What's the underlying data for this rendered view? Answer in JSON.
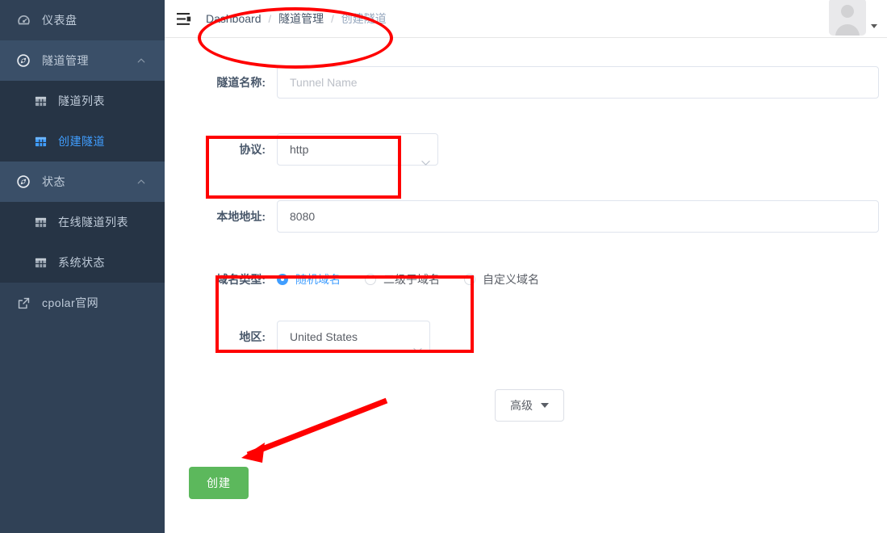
{
  "sidebar": {
    "items": [
      {
        "label": "仪表盘",
        "icon": "dashboard-icon",
        "type": "item"
      },
      {
        "label": "隧道管理",
        "icon": "compass-icon",
        "type": "group",
        "expanded": true,
        "children": [
          {
            "label": "隧道列表",
            "icon": "grid-icon",
            "active": false
          },
          {
            "label": "创建隧道",
            "icon": "grid-icon",
            "active": true
          }
        ]
      },
      {
        "label": "状态",
        "icon": "compass-icon",
        "type": "group",
        "expanded": true,
        "children": [
          {
            "label": "在线隧道列表",
            "icon": "grid-icon",
            "active": false
          },
          {
            "label": "系统状态",
            "icon": "grid-icon",
            "active": false
          }
        ]
      },
      {
        "label": "cpolar官网",
        "icon": "external-link-icon",
        "type": "item"
      }
    ]
  },
  "topbar": {
    "menu_toggle_icon": "hamburger-icon",
    "breadcrumbs": [
      {
        "label": "Dashboard",
        "current": false
      },
      {
        "label": "隧道管理",
        "current": false
      },
      {
        "label": "创建隧道",
        "current": true
      }
    ],
    "separator": "/",
    "avatar_icon": "avatar-icon",
    "avatar_caret_icon": "chevron-down-icon"
  },
  "form": {
    "tunnel_name": {
      "label": "隧道名称:",
      "value": "",
      "placeholder": "Tunnel Name"
    },
    "protocol": {
      "label": "协议:",
      "value": "http"
    },
    "local_address": {
      "label": "本地地址:",
      "value": "8080",
      "placeholder": ""
    },
    "domain_type": {
      "label": "域名类型:",
      "options": [
        {
          "label": "随机域名",
          "checked": true
        },
        {
          "label": "二级子域名",
          "checked": false
        },
        {
          "label": "自定义域名",
          "checked": false
        }
      ]
    },
    "region": {
      "label": "地区:",
      "value": "United States"
    },
    "advanced_button": "高级",
    "create_button": "创建"
  },
  "colors": {
    "sidebar_bg": "#304156",
    "submenu_bg": "#263445",
    "active_blue": "#409eff",
    "create_green": "#5cb85c",
    "annotation_red": "#ff0000"
  }
}
